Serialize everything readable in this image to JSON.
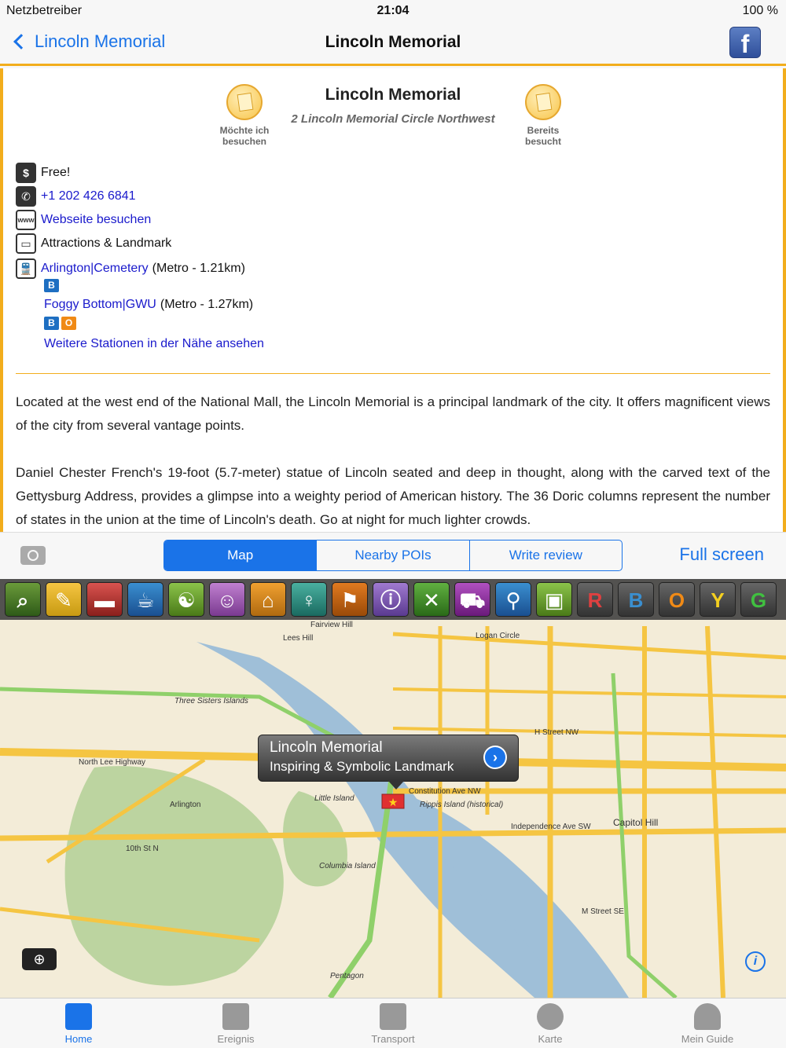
{
  "status": {
    "carrier": "Netzbetreiber",
    "time": "21:04",
    "battery": "100 %"
  },
  "nav": {
    "back_label": "Lincoln Memorial",
    "title": "Lincoln Memorial"
  },
  "header": {
    "name": "Lincoln Memorial",
    "address": "2 Lincoln Memorial Circle Northwest",
    "want_visit": "Möchte ich besuchen",
    "visited": "Bereits besucht"
  },
  "info": {
    "price": "Free!",
    "phone": "+1 202 426 6841",
    "website": "Webseite besuchen",
    "category": "Attractions & Landmark",
    "station1": "Arlington|Cemetery",
    "station1_dist": "(Metro - 1.21km)",
    "station2": "Foggy Bottom|GWU",
    "station2_dist": "(Metro - 1.27km)",
    "more_stations": "Weitere Stationen in der Nähe ansehen",
    "badges1": [
      "B"
    ],
    "badges2": [
      "B",
      "O"
    ]
  },
  "description": [
    "Located at the west end of the National Mall, the Lincoln Memorial is a principal landmark of the city. It offers magnificent views of the city from several vantage points.",
    "Daniel Chester French's 19-foot (5.7-meter) statue of Lincoln seated and deep in thought, along with the carved text of the Gettysburg Address, provides a glimpse into a weighty period of American history. The 36 Doric columns represent the number of states in the union at the time of Lincoln's death. Go at night for much lighter crowds."
  ],
  "segments": [
    "Map",
    "Nearby POIs",
    "Write review"
  ],
  "full_screen": "Full screen",
  "toolbar_letters": [
    "R",
    "B",
    "O",
    "Y",
    "G"
  ],
  "map": {
    "callout_title": "Lincoln Memorial",
    "callout_sub": "Inspiring & Symbolic Landmark",
    "labels": [
      "Fairview Hill",
      "Lees Hill",
      "Logan Circle",
      "Three Sisters Islands",
      "Little Island",
      "Columbia Island",
      "Arlington",
      "Capitol Hill",
      "Constitution Ave NW",
      "Independence Ave SW",
      "North Lee Highway",
      "10th St N",
      "Rippis Island (historical)",
      "H Street NW",
      "M Street SE",
      "Pentagon"
    ]
  },
  "tabs": [
    "Home",
    "Ereignis",
    "Transport",
    "Karte",
    "Mein Guide"
  ],
  "colors": {
    "accent": "#1a73e8",
    "border": "#f2ad1c",
    "water": "#9fbfd8",
    "park": "#bcd4a0",
    "road": "#f5c542"
  }
}
